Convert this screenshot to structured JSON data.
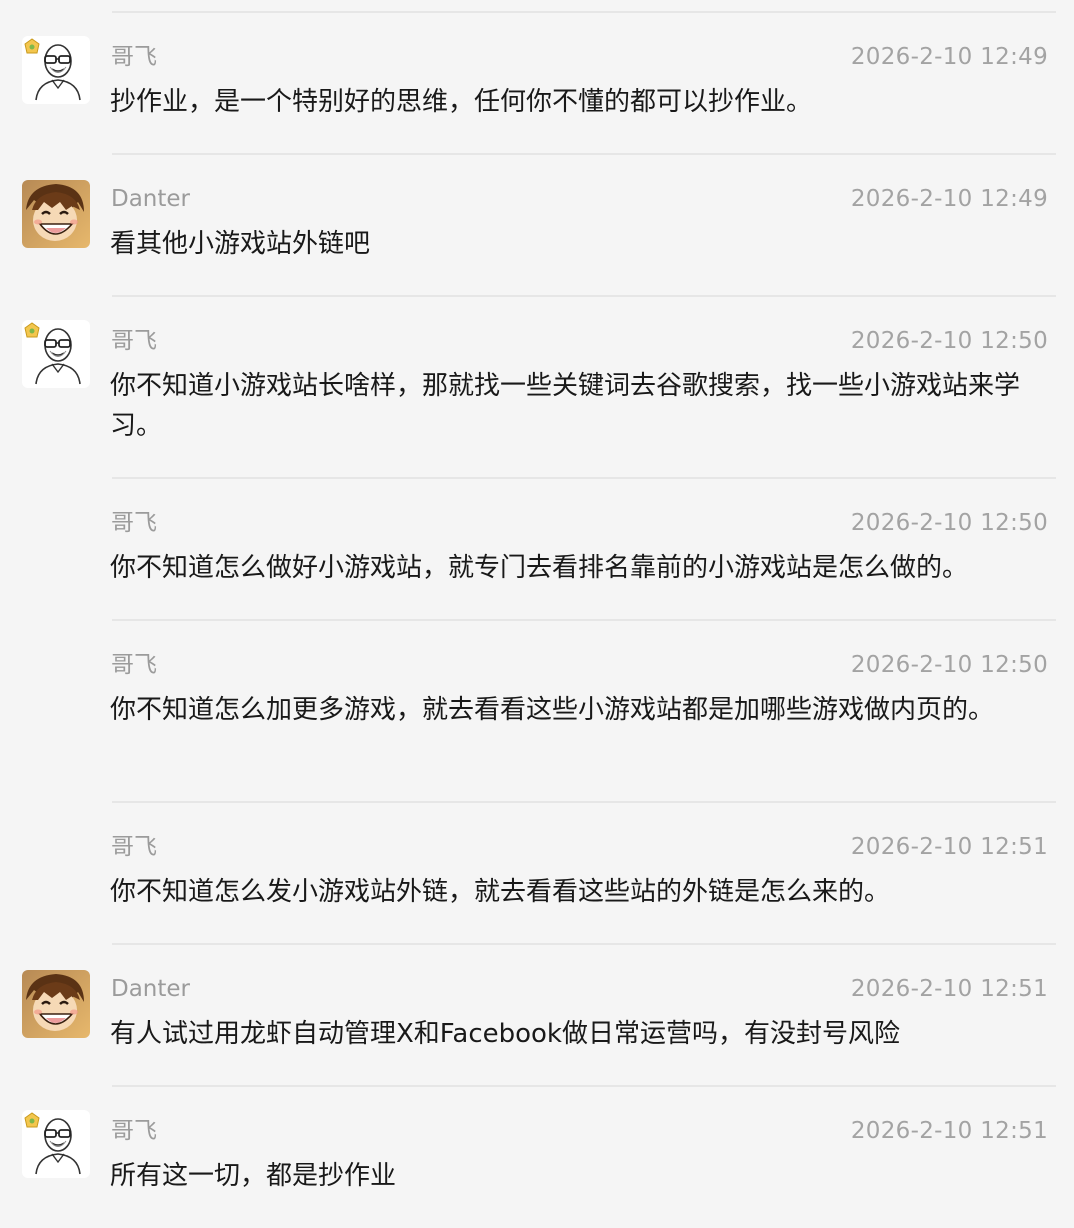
{
  "messages": [
    {
      "sender": "哥飞",
      "avatar_icon": "bald-man-glasses-avatar",
      "show_avatar": true,
      "time": "2026-2-10 12:49",
      "text": "抄作业，是一个特别好的思维，任何你不懂的都可以抄作业。"
    },
    {
      "sender": "Danter",
      "avatar_icon": "anime-boy-laughing-avatar",
      "show_avatar": true,
      "time": "2026-2-10 12:49",
      "text": "看其他小游戏站外链吧"
    },
    {
      "sender": "哥飞",
      "avatar_icon": "bald-man-glasses-avatar",
      "show_avatar": true,
      "time": "2026-2-10 12:50",
      "text": "你不知道小游戏站长啥样，那就找一些关键词去谷歌搜索，找一些小游戏站来学习。"
    },
    {
      "sender": "哥飞",
      "show_avatar": false,
      "time": "2026-2-10 12:50",
      "text": "你不知道怎么做好小游戏站，就专门去看排名靠前的小游戏站是怎么做的。"
    },
    {
      "sender": "哥飞",
      "show_avatar": false,
      "time": "2026-2-10 12:50",
      "text": "你不知道怎么加更多游戏，就去看看这些小游戏站都是加哪些游戏做内页的。"
    },
    {
      "sender": "哥飞",
      "show_avatar": false,
      "time": "2026-2-10 12:51",
      "text": "你不知道怎么发小游戏站外链，就去看看这些站的外链是怎么来的。"
    },
    {
      "sender": "Danter",
      "avatar_icon": "anime-boy-laughing-avatar",
      "show_avatar": true,
      "time": "2026-2-10 12:51",
      "text": "有人试过用龙虾自动管理X和Facebook做日常运营吗，有没封号风险"
    },
    {
      "sender": "哥飞",
      "avatar_icon": "bald-man-glasses-avatar",
      "show_avatar": true,
      "time": "2026-2-10 12:51",
      "text": "所有这一切，都是抄作业"
    }
  ]
}
